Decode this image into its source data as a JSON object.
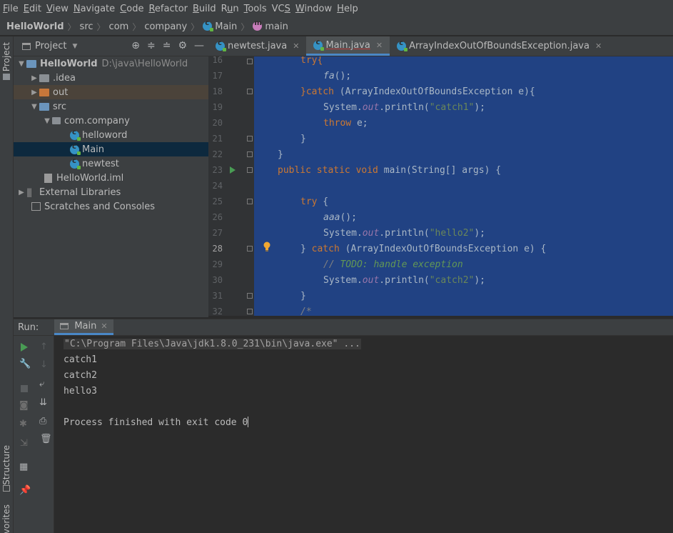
{
  "menu": [
    "File",
    "Edit",
    "View",
    "Navigate",
    "Code",
    "Refactor",
    "Build",
    "Run",
    "Tools",
    "VCS",
    "Window",
    "Help"
  ],
  "menu_mnemonic": [
    "F",
    "E",
    "V",
    "N",
    "C",
    "R",
    "B",
    "u",
    "T",
    "S",
    "W",
    "H"
  ],
  "breadcrumb": {
    "project": "HelloWorld",
    "src": "src",
    "pkg1": "com",
    "pkg2": "company",
    "cls": "Main",
    "method": "main"
  },
  "stripe": {
    "project": "Project",
    "structure": "Structure",
    "favorites": "vorites"
  },
  "project_panel": {
    "title": "Project",
    "tree": [
      {
        "label": "HelloWorld",
        "extra": "D:\\java\\HelloWorld",
        "bold": true
      },
      {
        "label": ".idea"
      },
      {
        "label": "out"
      },
      {
        "label": "src"
      },
      {
        "label": "com.company"
      },
      {
        "label": "helloword"
      },
      {
        "label": "Main"
      },
      {
        "label": "newtest"
      },
      {
        "label": "HelloWorld.iml"
      },
      {
        "label": "External Libraries"
      },
      {
        "label": "Scratches and Consoles"
      }
    ]
  },
  "tabs": [
    {
      "label": "newtest.java"
    },
    {
      "label": "Main.java"
    },
    {
      "label": "ArrayIndexOutOfBoundsException.java"
    }
  ],
  "code": {
    "lines": [
      "16",
      "17",
      "18",
      "19",
      "20",
      "21",
      "22",
      "23",
      "24",
      "25",
      "26",
      "27",
      "28",
      "29",
      "30",
      "31",
      "32"
    ],
    "current_line": "28",
    "t16": "try{",
    "t17": "fa",
    "t17b": "();",
    "t18a": "}catch",
    "t18b": " (ArrayIndexOutOfBoundsException e){",
    "t19a": "System.",
    "t19b": "out",
    "t19c": ".println(",
    "t19d": "\"catch1\"",
    "t19e": ");",
    "t20a": "throw",
    "t20b": " e;",
    "t21": "}",
    "t22": "}",
    "t23a": "public static void",
    "t23b": " main(String[] args) {",
    "t25a": "try",
    "t25b": " {",
    "t26a": "aaa",
    "t26b": "();",
    "t27d": "\"hello2\"",
    "t28a": "} ",
    "t28b": "catch",
    "t28c": " (ArrayIndexOutOfBoundsException e) {",
    "t29a": "// ",
    "t29b": "TODO: handle exception",
    "t30d": "\"catch2\"",
    "t31": "}",
    "t32": "/*"
  },
  "run": {
    "label": "Run:",
    "tab": "Main",
    "console": [
      "\"C:\\Program Files\\Java\\jdk1.8.0_231\\bin\\java.exe\" ...",
      "catch1",
      "catch2",
      "hello3",
      "",
      "Process finished with exit code 0"
    ]
  },
  "colors": {
    "accent": "#4a88c7",
    "selection": "#214283",
    "keyword": "#cc7832",
    "string": "#6a8759",
    "field": "#9876aa",
    "run_green": "#499c54"
  }
}
